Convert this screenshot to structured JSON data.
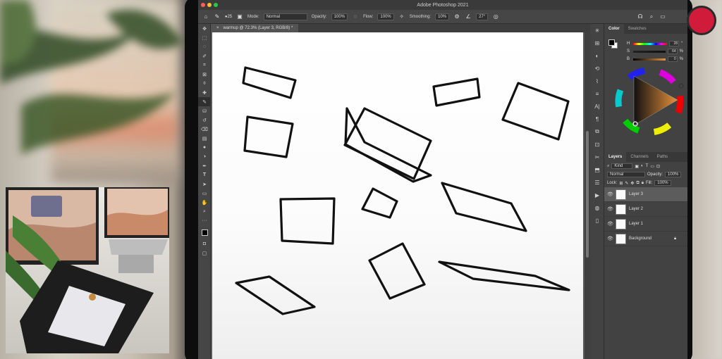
{
  "app": {
    "window_title": "Adobe Photoshop 2021",
    "document_tab": "warmup @ 72.3% (Layer 3, RGB/8) *"
  },
  "options_bar": {
    "brush_size": "25",
    "mode_label": "Mode:",
    "mode_value": "Normal",
    "opacity_label": "Opacity:",
    "opacity_value": "100%",
    "flow_label": "Flow:",
    "flow_value": "100%",
    "smoothing_label": "Smoothing:",
    "smoothing_value": "10%",
    "angle_value": "27°"
  },
  "color_panel": {
    "tabs": [
      "Color",
      "Swatches"
    ],
    "sliders": [
      {
        "label": "H",
        "value": "28",
        "unit": "°"
      },
      {
        "label": "S",
        "value": "64",
        "unit": "%"
      },
      {
        "label": "B",
        "value": "0",
        "unit": "%"
      }
    ],
    "hue_accent": "#e8913a"
  },
  "layers_panel": {
    "tabs": [
      "Layers",
      "Channels",
      "Paths"
    ],
    "filter_kind": "Kind",
    "blend_mode": "Normal",
    "opacity_label": "Opacity:",
    "opacity_value": "100%",
    "lock_label": "Lock:",
    "fill_label": "Fill:",
    "fill_value": "100%",
    "layers": [
      {
        "name": "Layer 3",
        "selected": true
      },
      {
        "name": "Layer 2",
        "selected": false
      },
      {
        "name": "Layer 1",
        "selected": false
      },
      {
        "name": "Background",
        "selected": false,
        "locked": true
      }
    ]
  },
  "colors": {
    "close": "#ff5f57",
    "minimize": "#febc2e",
    "zoom": "#28c840",
    "record_button": "#d11b3b"
  }
}
